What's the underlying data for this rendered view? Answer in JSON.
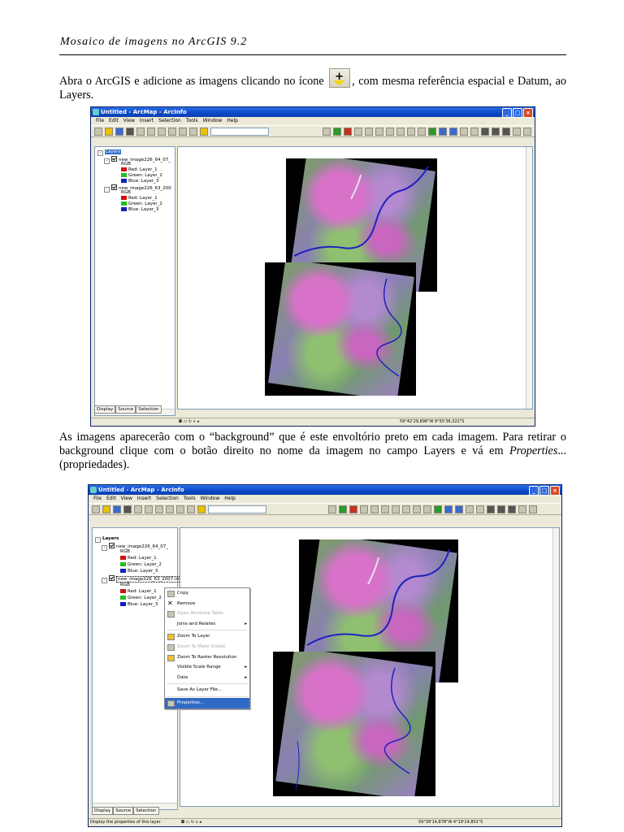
{
  "header": {
    "title": "Mosaico de imagens no ArcGIS 9.2"
  },
  "para1": {
    "before_icon": "Abra o ArcGIS e adicione as imagens clicando no ícone ",
    "after_icon": ", com mesma referência espacial e Datum, ao Layers.",
    "icon": "add-data-icon"
  },
  "para2": {
    "text": "As imagens aparecerão com o “background” que é este envoltório preto em cada imagem. Para retirar o background clique com o botão direito no nome da imagem no campo Layers e vá em ",
    "italic": "Properties",
    "tail": "... (propriedades)."
  },
  "window": {
    "title": "Untitled - ArcMap - ArcInfo",
    "menu": [
      "File",
      "Edit",
      "View",
      "Insert",
      "Selection",
      "Tools",
      "Window",
      "Help"
    ]
  },
  "toc": {
    "root": "Layers",
    "layer1": "new_image226_64_07_",
    "layer2_ss1": "new_image226_63_200",
    "layer2_ss2": "new_image226_63_2007.img",
    "rgb": "RGB",
    "bands": [
      {
        "label": "Red:   Layer_1",
        "color": "#d01010"
      },
      {
        "label": "Green: Layer_2",
        "color": "#20c020"
      },
      {
        "label": "Blue:  Layer_3",
        "color": "#1020c0"
      }
    ],
    "tabs": [
      "Display",
      "Source",
      "Selection"
    ]
  },
  "status": {
    "coords1": "59°42'29,896\"W  9°55'36,322\"S",
    "coords2": "59°39'14,878\"W  4°19'14,801\"S",
    "hint": "Display the properties of this layer"
  },
  "context_menu": {
    "items": [
      {
        "label": "Copy",
        "icon": "copy-icon",
        "disabled": false
      },
      {
        "label": "Remove",
        "icon": "remove-icon",
        "disabled": false
      },
      {
        "label": "Open Attribute Table",
        "icon": "table-icon",
        "disabled": true
      },
      {
        "label": "Joins and Relates",
        "icon": "",
        "disabled": false,
        "submenu": true
      },
      {
        "label": "Zoom To Layer",
        "icon": "zoom-layer-icon",
        "disabled": false
      },
      {
        "label": "Zoom To Make Visible",
        "icon": "zoom-visible-icon",
        "disabled": true
      },
      {
        "label": "Zoom To Raster Resolution",
        "icon": "zoom-raster-icon",
        "disabled": false
      },
      {
        "label": "Visible Scale Range",
        "icon": "",
        "disabled": false,
        "submenu": true
      },
      {
        "label": "Data",
        "icon": "",
        "disabled": false,
        "submenu": true
      },
      {
        "label": "Save As Layer File...",
        "icon": "",
        "disabled": false
      },
      {
        "label": "Properties...",
        "icon": "properties-icon",
        "disabled": false,
        "highlighted": true
      }
    ]
  }
}
